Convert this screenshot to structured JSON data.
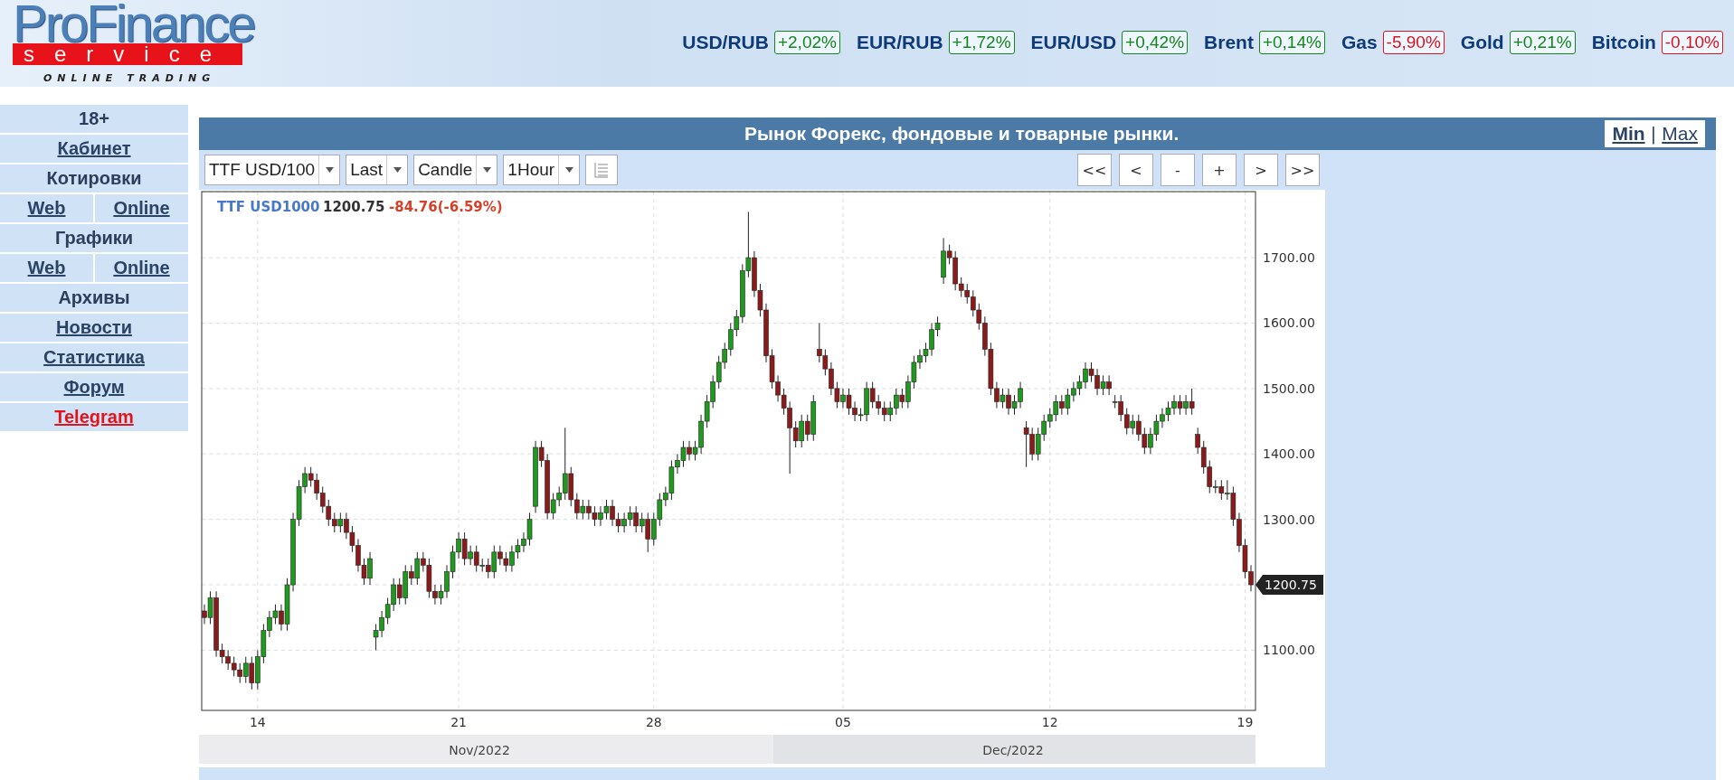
{
  "header": {
    "logo": {
      "title": "ProFinance",
      "subtitle": "service",
      "tagline": "ONLINE TRADING"
    },
    "tickers": [
      {
        "name": "USD/RUB",
        "change": "+2,02%",
        "color": "#15861a"
      },
      {
        "name": "EUR/RUB",
        "change": "+1,72%",
        "color": "#15861a"
      },
      {
        "name": "EUR/USD",
        "change": "+0,42%",
        "color": "#15861a"
      },
      {
        "name": "Brent",
        "change": "+0,14%",
        "color": "#15861a"
      },
      {
        "name": "Gas",
        "change": "-5,90%",
        "color": "#d8141c"
      },
      {
        "name": "Gold",
        "change": "+0,21%",
        "color": "#15861a"
      },
      {
        "name": "Bitcoin",
        "change": "-0,10%",
        "color": "#d8141c"
      }
    ]
  },
  "sidebar": {
    "items": [
      {
        "kind": "heading",
        "label": "18+"
      },
      {
        "kind": "link",
        "label": "Кабинет"
      },
      {
        "kind": "heading",
        "label": "Котировки"
      },
      {
        "kind": "pair",
        "links": [
          "Web",
          "Online"
        ]
      },
      {
        "kind": "heading",
        "label": "Графики"
      },
      {
        "kind": "pair",
        "links": [
          "Web",
          "Online"
        ]
      },
      {
        "kind": "heading",
        "label": "Архивы"
      },
      {
        "kind": "link",
        "label": "Новости"
      },
      {
        "kind": "link",
        "label": "Статистика"
      },
      {
        "kind": "link",
        "label": "Форум"
      },
      {
        "kind": "accent",
        "label": "Telegram"
      }
    ]
  },
  "panel": {
    "title": "Рынок Форекс, фондовые и товарные рынки.",
    "size_links": [
      "Min",
      "Max"
    ],
    "separator": "|",
    "toolbar": {
      "selects": [
        "TTF USD/100",
        "Last",
        "Candle",
        "1Hour"
      ],
      "nav_buttons": [
        "<<",
        "<",
        "-",
        "+",
        ">",
        ">>"
      ]
    },
    "chart": {
      "legend": {
        "symbol": "TTF USD1000",
        "price": "1200.75",
        "change": "-84.76(-6.59%)"
      },
      "last_price_tag": "1200.75",
      "months": [
        "Nov/2022",
        "Dec/2022"
      ],
      "chart_data": {
        "type": "candlestick",
        "grid": true,
        "yticks": [
          {
            "value": 1100,
            "label": "1100.00"
          },
          {
            "value": 1300,
            "label": "1300.00"
          },
          {
            "value": 1400,
            "label": "1400.00"
          },
          {
            "value": 1500,
            "label": "1500.00"
          },
          {
            "value": 1600,
            "label": "1600.00"
          },
          {
            "value": 1700,
            "label": "1700.00"
          }
        ],
        "ylim": [
          1008,
          1801
        ],
        "categories": [
          null,
          null,
          null,
          null,
          null,
          null,
          null,
          null,
          null,
          "14",
          null,
          null,
          null,
          null,
          null,
          null,
          null,
          null,
          null,
          null,
          null,
          null,
          null,
          null,
          null,
          null,
          null,
          null,
          null,
          null,
          null,
          null,
          null,
          null,
          null,
          null,
          null,
          null,
          null,
          null,
          null,
          null,
          null,
          "21",
          null,
          null,
          null,
          null,
          null,
          null,
          null,
          null,
          null,
          null,
          null,
          null,
          null,
          null,
          null,
          null,
          null,
          null,
          null,
          null,
          null,
          null,
          null,
          null,
          null,
          null,
          null,
          null,
          null,
          null,
          null,
          null,
          "28",
          null,
          null,
          null,
          null,
          null,
          null,
          null,
          null,
          null,
          null,
          null,
          null,
          null,
          null,
          null,
          null,
          null,
          null,
          null,
          null,
          null,
          null,
          null,
          null,
          null,
          null,
          null,
          null,
          null,
          null,
          null,
          "05",
          null,
          null,
          null,
          null,
          null,
          null,
          null,
          null,
          null,
          null,
          null,
          null,
          null,
          null,
          null,
          null,
          null,
          null,
          null,
          null,
          null,
          null,
          null,
          null,
          null,
          null,
          null,
          null,
          null,
          null,
          null,
          null,
          null,
          null,
          "12",
          null,
          null,
          null,
          null,
          null,
          null,
          null,
          null,
          null,
          null,
          null,
          null,
          null,
          null,
          null,
          null,
          null,
          null,
          null,
          null,
          null,
          null,
          null,
          null,
          null,
          null,
          null,
          null,
          null,
          null,
          null,
          null,
          "19",
          null
        ],
        "ohlc": [
          [
            1160,
            1170,
            1140,
            1150
          ],
          [
            1150,
            1190,
            1140,
            1180
          ],
          [
            1180,
            1190,
            1090,
            1100
          ],
          [
            1100,
            1110,
            1080,
            1090
          ],
          [
            1090,
            1100,
            1070,
            1080
          ],
          [
            1080,
            1090,
            1060,
            1070
          ],
          [
            1070,
            1080,
            1050,
            1060
          ],
          [
            1060,
            1090,
            1050,
            1080
          ],
          [
            1080,
            1090,
            1040,
            1050
          ],
          [
            1050,
            1100,
            1040,
            1090
          ],
          [
            1090,
            1140,
            1080,
            1130
          ],
          [
            1130,
            1160,
            1120,
            1150
          ],
          [
            1150,
            1170,
            1140,
            1160
          ],
          [
            1160,
            1170,
            1130,
            1140
          ],
          [
            1140,
            1210,
            1130,
            1200
          ],
          [
            1200,
            1310,
            1190,
            1300
          ],
          [
            1300,
            1360,
            1290,
            1350
          ],
          [
            1350,
            1380,
            1340,
            1370
          ],
          [
            1370,
            1380,
            1350,
            1360
          ],
          [
            1360,
            1370,
            1330,
            1340
          ],
          [
            1340,
            1350,
            1310,
            1320
          ],
          [
            1320,
            1330,
            1290,
            1300
          ],
          [
            1300,
            1310,
            1280,
            1290
          ],
          [
            1290,
            1310,
            1280,
            1300
          ],
          [
            1300,
            1310,
            1270,
            1280
          ],
          [
            1280,
            1290,
            1250,
            1260
          ],
          [
            1260,
            1270,
            1220,
            1230
          ],
          [
            1230,
            1240,
            1200,
            1210
          ],
          [
            1210,
            1250,
            1200,
            1240
          ],
          [
            1120,
            1140,
            1100,
            1130
          ],
          [
            1130,
            1160,
            1120,
            1150
          ],
          [
            1150,
            1180,
            1140,
            1170
          ],
          [
            1170,
            1210,
            1160,
            1200
          ],
          [
            1200,
            1210,
            1170,
            1180
          ],
          [
            1180,
            1230,
            1170,
            1220
          ],
          [
            1220,
            1230,
            1200,
            1210
          ],
          [
            1210,
            1250,
            1200,
            1240
          ],
          [
            1240,
            1250,
            1220,
            1230
          ],
          [
            1230,
            1240,
            1180,
            1190
          ],
          [
            1190,
            1200,
            1170,
            1180
          ],
          [
            1180,
            1200,
            1170,
            1190
          ],
          [
            1190,
            1230,
            1180,
            1220
          ],
          [
            1220,
            1260,
            1210,
            1250
          ],
          [
            1250,
            1280,
            1240,
            1270
          ],
          [
            1270,
            1280,
            1230,
            1240
          ],
          [
            1240,
            1260,
            1230,
            1250
          ],
          [
            1250,
            1260,
            1220,
            1230
          ],
          [
            1230,
            1240,
            1220,
            1230
          ],
          [
            1230,
            1240,
            1210,
            1220
          ],
          [
            1220,
            1260,
            1210,
            1250
          ],
          [
            1250,
            1260,
            1230,
            1240
          ],
          [
            1240,
            1250,
            1220,
            1230
          ],
          [
            1230,
            1260,
            1220,
            1250
          ],
          [
            1250,
            1270,
            1240,
            1260
          ],
          [
            1260,
            1280,
            1250,
            1270
          ],
          [
            1270,
            1310,
            1260,
            1300
          ],
          [
            1320,
            1420,
            1310,
            1410
          ],
          [
            1410,
            1420,
            1380,
            1390
          ],
          [
            1390,
            1400,
            1300,
            1310
          ],
          [
            1310,
            1340,
            1300,
            1330
          ],
          [
            1330,
            1350,
            1320,
            1340
          ],
          [
            1340,
            1440,
            1330,
            1370
          ],
          [
            1370,
            1380,
            1320,
            1330
          ],
          [
            1330,
            1340,
            1300,
            1310
          ],
          [
            1310,
            1330,
            1300,
            1320
          ],
          [
            1320,
            1330,
            1300,
            1310
          ],
          [
            1310,
            1320,
            1290,
            1300
          ],
          [
            1300,
            1320,
            1290,
            1310
          ],
          [
            1310,
            1330,
            1300,
            1320
          ],
          [
            1320,
            1330,
            1290,
            1300
          ],
          [
            1300,
            1310,
            1280,
            1290
          ],
          [
            1290,
            1310,
            1280,
            1300
          ],
          [
            1300,
            1320,
            1290,
            1310
          ],
          [
            1310,
            1320,
            1280,
            1290
          ],
          [
            1290,
            1310,
            1280,
            1300
          ],
          [
            1300,
            1310,
            1250,
            1270
          ],
          [
            1270,
            1310,
            1260,
            1300
          ],
          [
            1300,
            1340,
            1290,
            1330
          ],
          [
            1330,
            1350,
            1320,
            1340
          ],
          [
            1340,
            1390,
            1330,
            1380
          ],
          [
            1380,
            1400,
            1370,
            1390
          ],
          [
            1390,
            1420,
            1380,
            1410
          ],
          [
            1410,
            1420,
            1390,
            1400
          ],
          [
            1400,
            1420,
            1390,
            1410
          ],
          [
            1410,
            1460,
            1400,
            1450
          ],
          [
            1450,
            1490,
            1440,
            1480
          ],
          [
            1480,
            1520,
            1470,
            1510
          ],
          [
            1510,
            1550,
            1500,
            1540
          ],
          [
            1540,
            1570,
            1530,
            1560
          ],
          [
            1560,
            1600,
            1550,
            1590
          ],
          [
            1590,
            1620,
            1580,
            1610
          ],
          [
            1610,
            1690,
            1600,
            1680
          ],
          [
            1680,
            1770,
            1670,
            1700
          ],
          [
            1700,
            1710,
            1640,
            1650
          ],
          [
            1650,
            1660,
            1610,
            1620
          ],
          [
            1620,
            1630,
            1540,
            1550
          ],
          [
            1550,
            1560,
            1500,
            1510
          ],
          [
            1510,
            1520,
            1480,
            1490
          ],
          [
            1490,
            1500,
            1460,
            1470
          ],
          [
            1470,
            1480,
            1370,
            1440
          ],
          [
            1440,
            1450,
            1410,
            1420
          ],
          [
            1420,
            1460,
            1410,
            1450
          ],
          [
            1450,
            1460,
            1420,
            1430
          ],
          [
            1430,
            1490,
            1420,
            1480
          ],
          [
            1560,
            1600,
            1540,
            1550
          ],
          [
            1550,
            1560,
            1520,
            1530
          ],
          [
            1530,
            1540,
            1490,
            1500
          ],
          [
            1500,
            1510,
            1470,
            1480
          ],
          [
            1480,
            1500,
            1470,
            1490
          ],
          [
            1490,
            1500,
            1460,
            1470
          ],
          [
            1470,
            1480,
            1450,
            1460
          ],
          [
            1460,
            1470,
            1450,
            1460
          ],
          [
            1460,
            1510,
            1450,
            1500
          ],
          [
            1500,
            1510,
            1470,
            1480
          ],
          [
            1480,
            1490,
            1460,
            1470
          ],
          [
            1470,
            1480,
            1450,
            1460
          ],
          [
            1460,
            1480,
            1450,
            1470
          ],
          [
            1470,
            1500,
            1460,
            1490
          ],
          [
            1490,
            1500,
            1470,
            1480
          ],
          [
            1480,
            1520,
            1470,
            1510
          ],
          [
            1510,
            1550,
            1500,
            1540
          ],
          [
            1540,
            1560,
            1530,
            1550
          ],
          [
            1550,
            1570,
            1540,
            1560
          ],
          [
            1560,
            1600,
            1550,
            1590
          ],
          [
            1590,
            1610,
            1580,
            1600
          ],
          [
            1670,
            1730,
            1660,
            1710
          ],
          [
            1710,
            1720,
            1690,
            1700
          ],
          [
            1700,
            1710,
            1650,
            1660
          ],
          [
            1660,
            1670,
            1640,
            1650
          ],
          [
            1650,
            1660,
            1630,
            1640
          ],
          [
            1640,
            1650,
            1610,
            1620
          ],
          [
            1620,
            1630,
            1590,
            1600
          ],
          [
            1600,
            1610,
            1550,
            1560
          ],
          [
            1560,
            1570,
            1490,
            1500
          ],
          [
            1500,
            1510,
            1470,
            1480
          ],
          [
            1480,
            1500,
            1470,
            1490
          ],
          [
            1490,
            1500,
            1460,
            1470
          ],
          [
            1470,
            1490,
            1460,
            1480
          ],
          [
            1480,
            1510,
            1470,
            1500
          ],
          [
            1440,
            1450,
            1380,
            1430
          ],
          [
            1430,
            1440,
            1390,
            1400
          ],
          [
            1400,
            1440,
            1390,
            1430
          ],
          [
            1430,
            1460,
            1420,
            1450
          ],
          [
            1450,
            1470,
            1440,
            1460
          ],
          [
            1460,
            1490,
            1450,
            1480
          ],
          [
            1480,
            1490,
            1460,
            1470
          ],
          [
            1470,
            1500,
            1460,
            1490
          ],
          [
            1490,
            1510,
            1480,
            1500
          ],
          [
            1500,
            1520,
            1490,
            1510
          ],
          [
            1510,
            1540,
            1500,
            1530
          ],
          [
            1530,
            1540,
            1510,
            1520
          ],
          [
            1520,
            1530,
            1490,
            1500
          ],
          [
            1500,
            1520,
            1490,
            1510
          ],
          [
            1510,
            1520,
            1490,
            1500
          ],
          [
            1480,
            1490,
            1470,
            1480
          ],
          [
            1480,
            1490,
            1450,
            1460
          ],
          [
            1460,
            1470,
            1430,
            1440
          ],
          [
            1440,
            1460,
            1430,
            1450
          ],
          [
            1450,
            1460,
            1420,
            1430
          ],
          [
            1430,
            1440,
            1400,
            1410
          ],
          [
            1410,
            1440,
            1400,
            1430
          ],
          [
            1430,
            1460,
            1420,
            1450
          ],
          [
            1450,
            1470,
            1440,
            1460
          ],
          [
            1460,
            1480,
            1450,
            1470
          ],
          [
            1470,
            1490,
            1460,
            1480
          ],
          [
            1480,
            1490,
            1460,
            1470
          ],
          [
            1470,
            1490,
            1460,
            1480
          ],
          [
            1480,
            1500,
            1460,
            1470
          ],
          [
            1430,
            1440,
            1400,
            1410
          ],
          [
            1410,
            1420,
            1370,
            1380
          ],
          [
            1380,
            1390,
            1340,
            1350
          ],
          [
            1350,
            1360,
            1340,
            1350
          ],
          [
            1350,
            1360,
            1330,
            1340
          ],
          [
            1340,
            1360,
            1330,
            1340
          ],
          [
            1340,
            1350,
            1290,
            1300
          ],
          [
            1300,
            1310,
            1250,
            1260
          ],
          [
            1260,
            1270,
            1210,
            1220
          ],
          [
            1220,
            1230,
            1190,
            1200
          ]
        ]
      }
    }
  }
}
